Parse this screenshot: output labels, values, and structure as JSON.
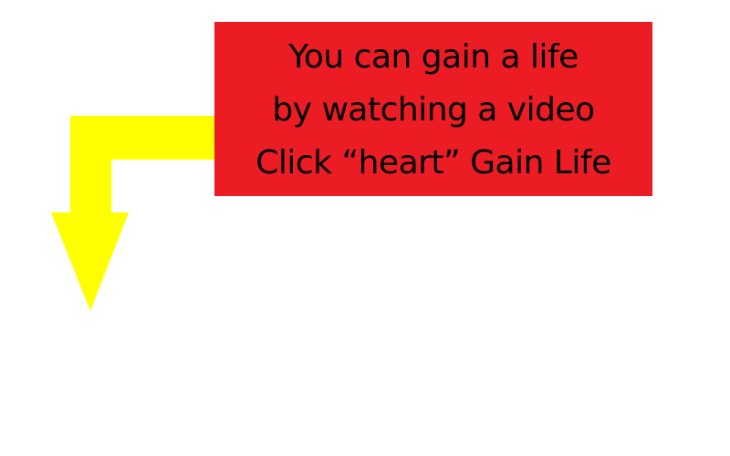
{
  "tutorial": {
    "callout": {
      "lines": [
        "You can gain a life",
        "by watching a video",
        "Click “heart” Gain Life"
      ]
    },
    "pointer": {
      "icon": "down-arrow-icon",
      "direction": "down"
    }
  },
  "colors": {
    "background": "#ffffff",
    "callout_bg": "#ec1c24",
    "callout_text": "#000000",
    "arrow": "#ffff00"
  }
}
